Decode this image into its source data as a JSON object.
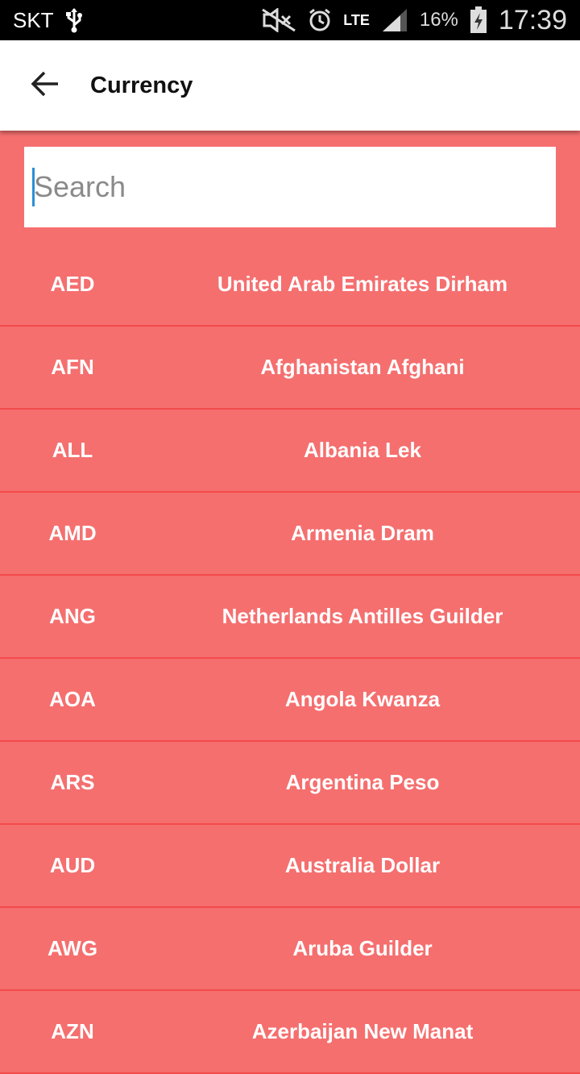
{
  "status_bar": {
    "carrier": "SKT",
    "network": "LTE",
    "battery": "16%",
    "time": "17:39"
  },
  "appbar": {
    "title": "Currency"
  },
  "search": {
    "placeholder": "Search",
    "value": ""
  },
  "currencies": [
    {
      "code": "AED",
      "name": "United Arab Emirates Dirham"
    },
    {
      "code": "AFN",
      "name": "Afghanistan Afghani"
    },
    {
      "code": "ALL",
      "name": "Albania Lek"
    },
    {
      "code": "AMD",
      "name": "Armenia Dram"
    },
    {
      "code": "ANG",
      "name": "Netherlands Antilles Guilder"
    },
    {
      "code": "AOA",
      "name": "Angola Kwanza"
    },
    {
      "code": "ARS",
      "name": "Argentina Peso"
    },
    {
      "code": "AUD",
      "name": "Australia Dollar"
    },
    {
      "code": "AWG",
      "name": "Aruba Guilder"
    },
    {
      "code": "AZN",
      "name": "Azerbaijan New Manat"
    }
  ],
  "colors": {
    "background": "#f56f6f",
    "divider": "#f44a4a",
    "caret": "#2a8fd6"
  }
}
